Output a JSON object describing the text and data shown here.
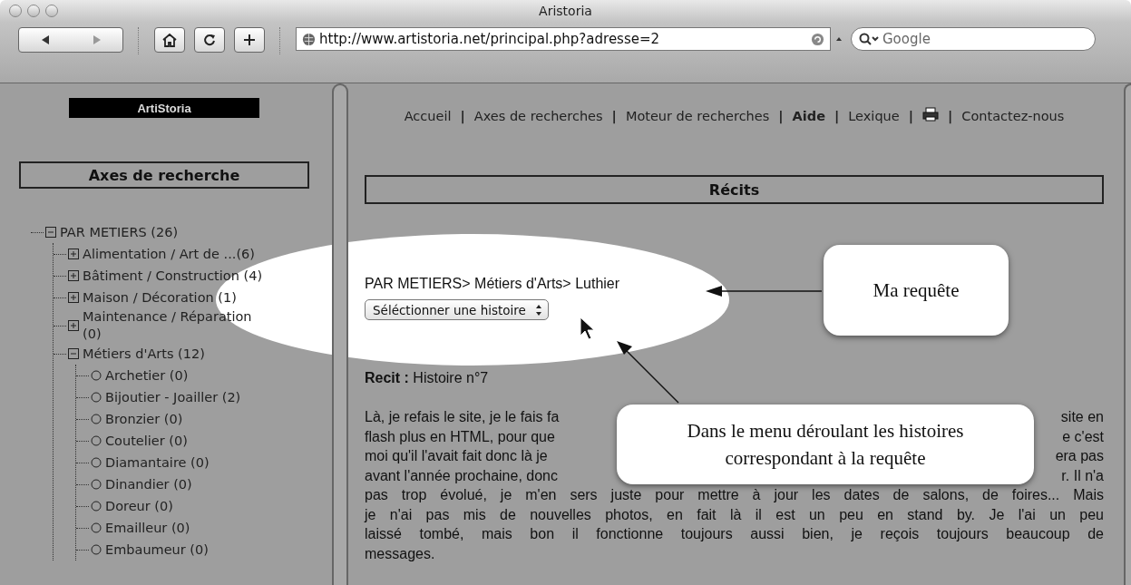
{
  "window": {
    "title": "Aristoria"
  },
  "toolbar": {
    "url": "http://www.artistoria.net/principal.php?adresse=2",
    "search_placeholder": "Google"
  },
  "sidebar": {
    "logo": "ArtiStoria",
    "heading": "Axes de recherche",
    "tree": [
      {
        "label": "PAR METIERS (26)",
        "kind": "folder",
        "expanded": true,
        "children": [
          {
            "label": "Alimentation / Art de ...(6)",
            "kind": "folder",
            "expanded": false
          },
          {
            "label": "Bâtiment / Construction (4)",
            "kind": "folder",
            "expanded": false
          },
          {
            "label": "Maison / Décoration (1)",
            "kind": "folder",
            "expanded": false
          },
          {
            "label": "Maintenance / Réparation (0)",
            "kind": "folder",
            "expanded": false
          },
          {
            "label": "Métiers d'Arts (12)",
            "kind": "folder",
            "expanded": true,
            "children": [
              {
                "label": "Archetier (0)",
                "kind": "leaf"
              },
              {
                "label": "Bijoutier - Joailler (2)",
                "kind": "leaf"
              },
              {
                "label": "Bronzier (0)",
                "kind": "leaf"
              },
              {
                "label": "Coutelier (0)",
                "kind": "leaf"
              },
              {
                "label": "Diamantaire (0)",
                "kind": "leaf"
              },
              {
                "label": "Dinandier (0)",
                "kind": "leaf"
              },
              {
                "label": "Doreur (0)",
                "kind": "leaf"
              },
              {
                "label": "Emailleur (0)",
                "kind": "leaf"
              },
              {
                "label": "Embaumeur (0)",
                "kind": "leaf"
              }
            ]
          }
        ]
      }
    ]
  },
  "nav": [
    {
      "label": "Accueil",
      "kind": "link",
      "bold": false
    },
    {
      "label": "|",
      "kind": "separator"
    },
    {
      "label": "Axes de recherches",
      "kind": "link",
      "bold": false
    },
    {
      "label": "|",
      "kind": "separator"
    },
    {
      "label": "Moteur de recherches",
      "kind": "link",
      "bold": false
    },
    {
      "label": "|",
      "kind": "separator"
    },
    {
      "label": "Aide",
      "kind": "link",
      "bold": true
    },
    {
      "label": "|",
      "kind": "separator"
    },
    {
      "label": "Lexique",
      "kind": "link",
      "bold": false
    },
    {
      "label": "|",
      "kind": "separator"
    },
    {
      "kind": "print"
    },
    {
      "label": "|",
      "kind": "separator"
    },
    {
      "label": "Contactez-nous",
      "kind": "link",
      "bold": false
    }
  ],
  "section_title": "Récits",
  "breadcrumb": "PAR METIERS> Métiers d'Arts> Luthier",
  "story_select": {
    "value": "Séléctionner une histoire"
  },
  "recit": "**Recit :** Histoire n°7",
  "story_lines": [
    {
      "parts": [
        "Là, je refais le site, je le fais fa",
        "site en"
      ]
    },
    {
      "parts": [
        "flash plus en HTML, pour que",
        "e c'est"
      ]
    },
    {
      "parts": [
        "moi qu'il l'avait fait donc là je",
        "era pas"
      ]
    },
    {
      "parts": [
        "avant l'année prochaine, donc",
        "r. Il n'a"
      ]
    },
    {
      "parts": [
        "pas trop évolué, je m'en sers juste pour mettre à jour les dates de salons, de foires... Mais"
      ]
    },
    {
      "parts": [
        "je n'ai pas mis de nouvelles photos, en fait là il est un peu en stand by. Je l'ai un peu"
      ]
    },
    {
      "parts": [
        "laissé tombé, mais bon il fonctionne toujours aussi bien, je reçois toujours beaucoup de"
      ]
    },
    {
      "parts": [
        "messages."
      ]
    }
  ],
  "callouts": [
    {
      "text": "Ma requête"
    },
    {
      "text": "Dans le menu déroulant les histoires correspondant à la requête"
    }
  ]
}
